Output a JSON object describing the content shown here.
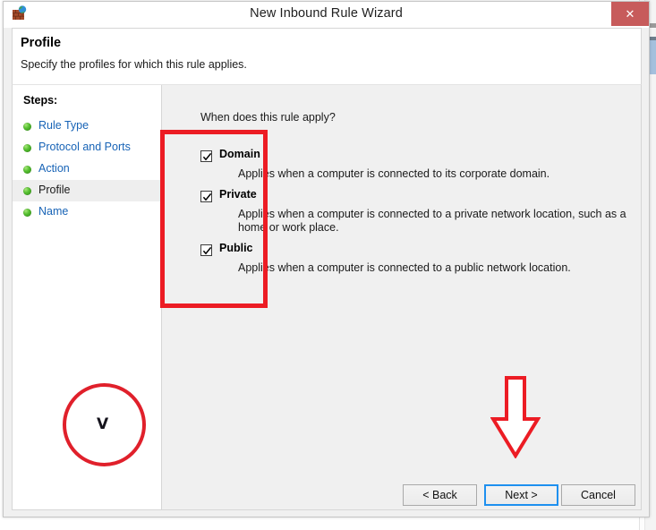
{
  "window": {
    "title": "New Inbound Rule Wizard",
    "app_icon": "firewall-icon",
    "close_label": "✕"
  },
  "header": {
    "title": "Profile",
    "subtitle": "Specify the profiles for which this rule applies."
  },
  "sidebar": {
    "heading": "Steps:",
    "items": [
      {
        "label": "Rule Type",
        "current": false
      },
      {
        "label": "Protocol and Ports",
        "current": false
      },
      {
        "label": "Action",
        "current": false
      },
      {
        "label": "Profile",
        "current": true
      },
      {
        "label": "Name",
        "current": false
      }
    ]
  },
  "content": {
    "question": "When does this rule apply?",
    "profiles": [
      {
        "name": "Domain",
        "checked": true,
        "description": "Applies when a computer is connected to its corporate domain."
      },
      {
        "name": "Private",
        "checked": true,
        "description": "Applies when a computer is connected to a private network location, such as a home or work place."
      },
      {
        "name": "Public",
        "checked": true,
        "description": "Applies when a computer is connected to a public network location."
      }
    ]
  },
  "footer": {
    "back_label": "< Back",
    "next_label": "Next >",
    "cancel_label": "Cancel"
  },
  "annotations": {
    "color": "#ec1c24",
    "rectangle_target": "profile-checkbox-group",
    "arrow_target": "next-button",
    "circle_glyph": "V"
  }
}
